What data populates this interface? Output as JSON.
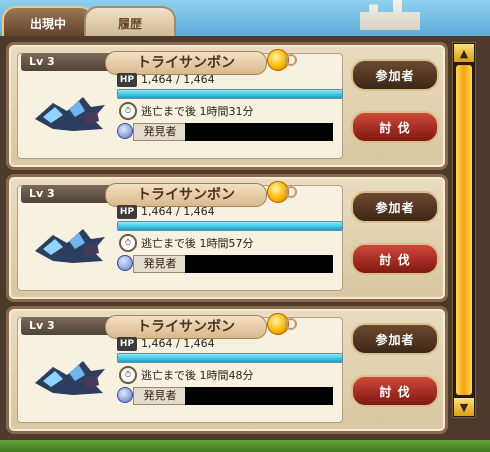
{
  "tabs": [
    {
      "label": "出現中",
      "active": true
    },
    {
      "label": "履歴",
      "active": false
    }
  ],
  "cards": [
    {
      "level": "Lv 3",
      "name": "トライサンボン",
      "hp_label": "HP",
      "hp_text": "1,464 / 1,464",
      "hp_fraction": 1.0,
      "time_text": "逃亡まで後 1時間31分",
      "finder_label": "発見者",
      "join_label": "参加者",
      "attack_label": "討 伐"
    },
    {
      "level": "Lv 3",
      "name": "トライサンボン",
      "hp_label": "HP",
      "hp_text": "1,464 / 1,464",
      "hp_fraction": 1.0,
      "time_text": "逃亡まで後 1時間57分",
      "finder_label": "発見者",
      "join_label": "参加者",
      "attack_label": "討 伐"
    },
    {
      "level": "Lv 3",
      "name": "トライサンボン",
      "hp_label": "HP",
      "hp_text": "1,464 / 1,464",
      "hp_fraction": 1.0,
      "time_text": "逃亡まで後 1時間48分",
      "finder_label": "発見者",
      "join_label": "参加者",
      "attack_label": "討 伐"
    }
  ],
  "scrollbar": {
    "up_icon": "▲",
    "down_icon": "▼"
  },
  "colors": {
    "hp_fill": "#1aa0c8",
    "attack_button": "#c0392b",
    "scroll_thumb": "#f5a20e"
  }
}
